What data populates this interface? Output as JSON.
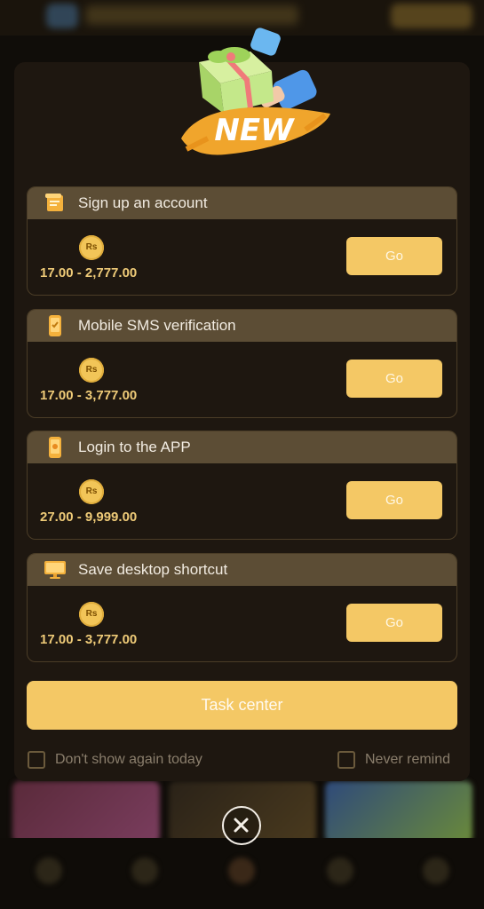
{
  "popup": {
    "badge_text": "NEW",
    "tasks": [
      {
        "title": "Sign up an account",
        "icon": "document-icon",
        "coin": "Rs",
        "reward": "17.00 - 2,777.00",
        "button": "Go"
      },
      {
        "title": "Mobile SMS verification",
        "icon": "smartphone-icon",
        "coin": "Rs",
        "reward": "17.00 - 3,777.00",
        "button": "Go"
      },
      {
        "title": "Login to the APP",
        "icon": "app-phone-icon",
        "coin": "Rs",
        "reward": "27.00 - 9,999.00",
        "button": "Go"
      },
      {
        "title": "Save desktop shortcut",
        "icon": "monitor-icon",
        "coin": "Rs",
        "reward": "17.00 - 3,777.00",
        "button": "Go"
      }
    ],
    "task_center_label": "Task center",
    "dont_show_today_label": "Don't show again today",
    "never_remind_label": "Never remind",
    "close_icon": "close-icon"
  },
  "colors": {
    "accent": "#f4c865",
    "modal_bg": "#1e1710",
    "task_header_bg": "#5c4d35",
    "reward_text": "#efcb78"
  }
}
